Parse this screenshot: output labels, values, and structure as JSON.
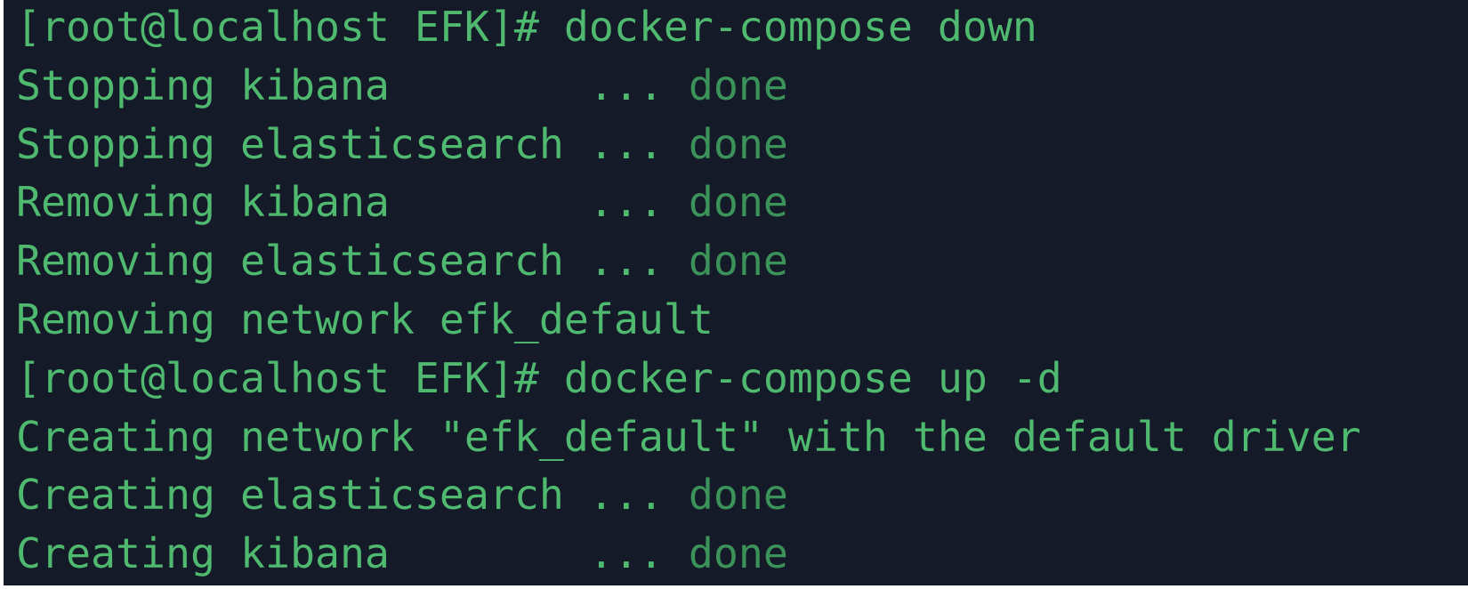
{
  "terminal": {
    "lines": [
      {
        "text": "[root@localhost EFK]# docker-compose down",
        "status": ""
      },
      {
        "text": "Stopping kibana        ... ",
        "status": "done"
      },
      {
        "text": "Stopping elasticsearch ... ",
        "status": "done"
      },
      {
        "text": "Removing kibana        ... ",
        "status": "done"
      },
      {
        "text": "Removing elasticsearch ... ",
        "status": "done"
      },
      {
        "text": "Removing network efk_default",
        "status": ""
      },
      {
        "text": "[root@localhost EFK]# docker-compose up -d",
        "status": ""
      },
      {
        "text": "Creating network \"efk_default\" with the default driver",
        "status": ""
      },
      {
        "text": "Creating elasticsearch ... ",
        "status": "done"
      },
      {
        "text": "Creating kibana        ... ",
        "status": "done"
      }
    ]
  },
  "colors": {
    "background": "#151a28",
    "text": "#4fb96f",
    "status": "#3b9359"
  }
}
